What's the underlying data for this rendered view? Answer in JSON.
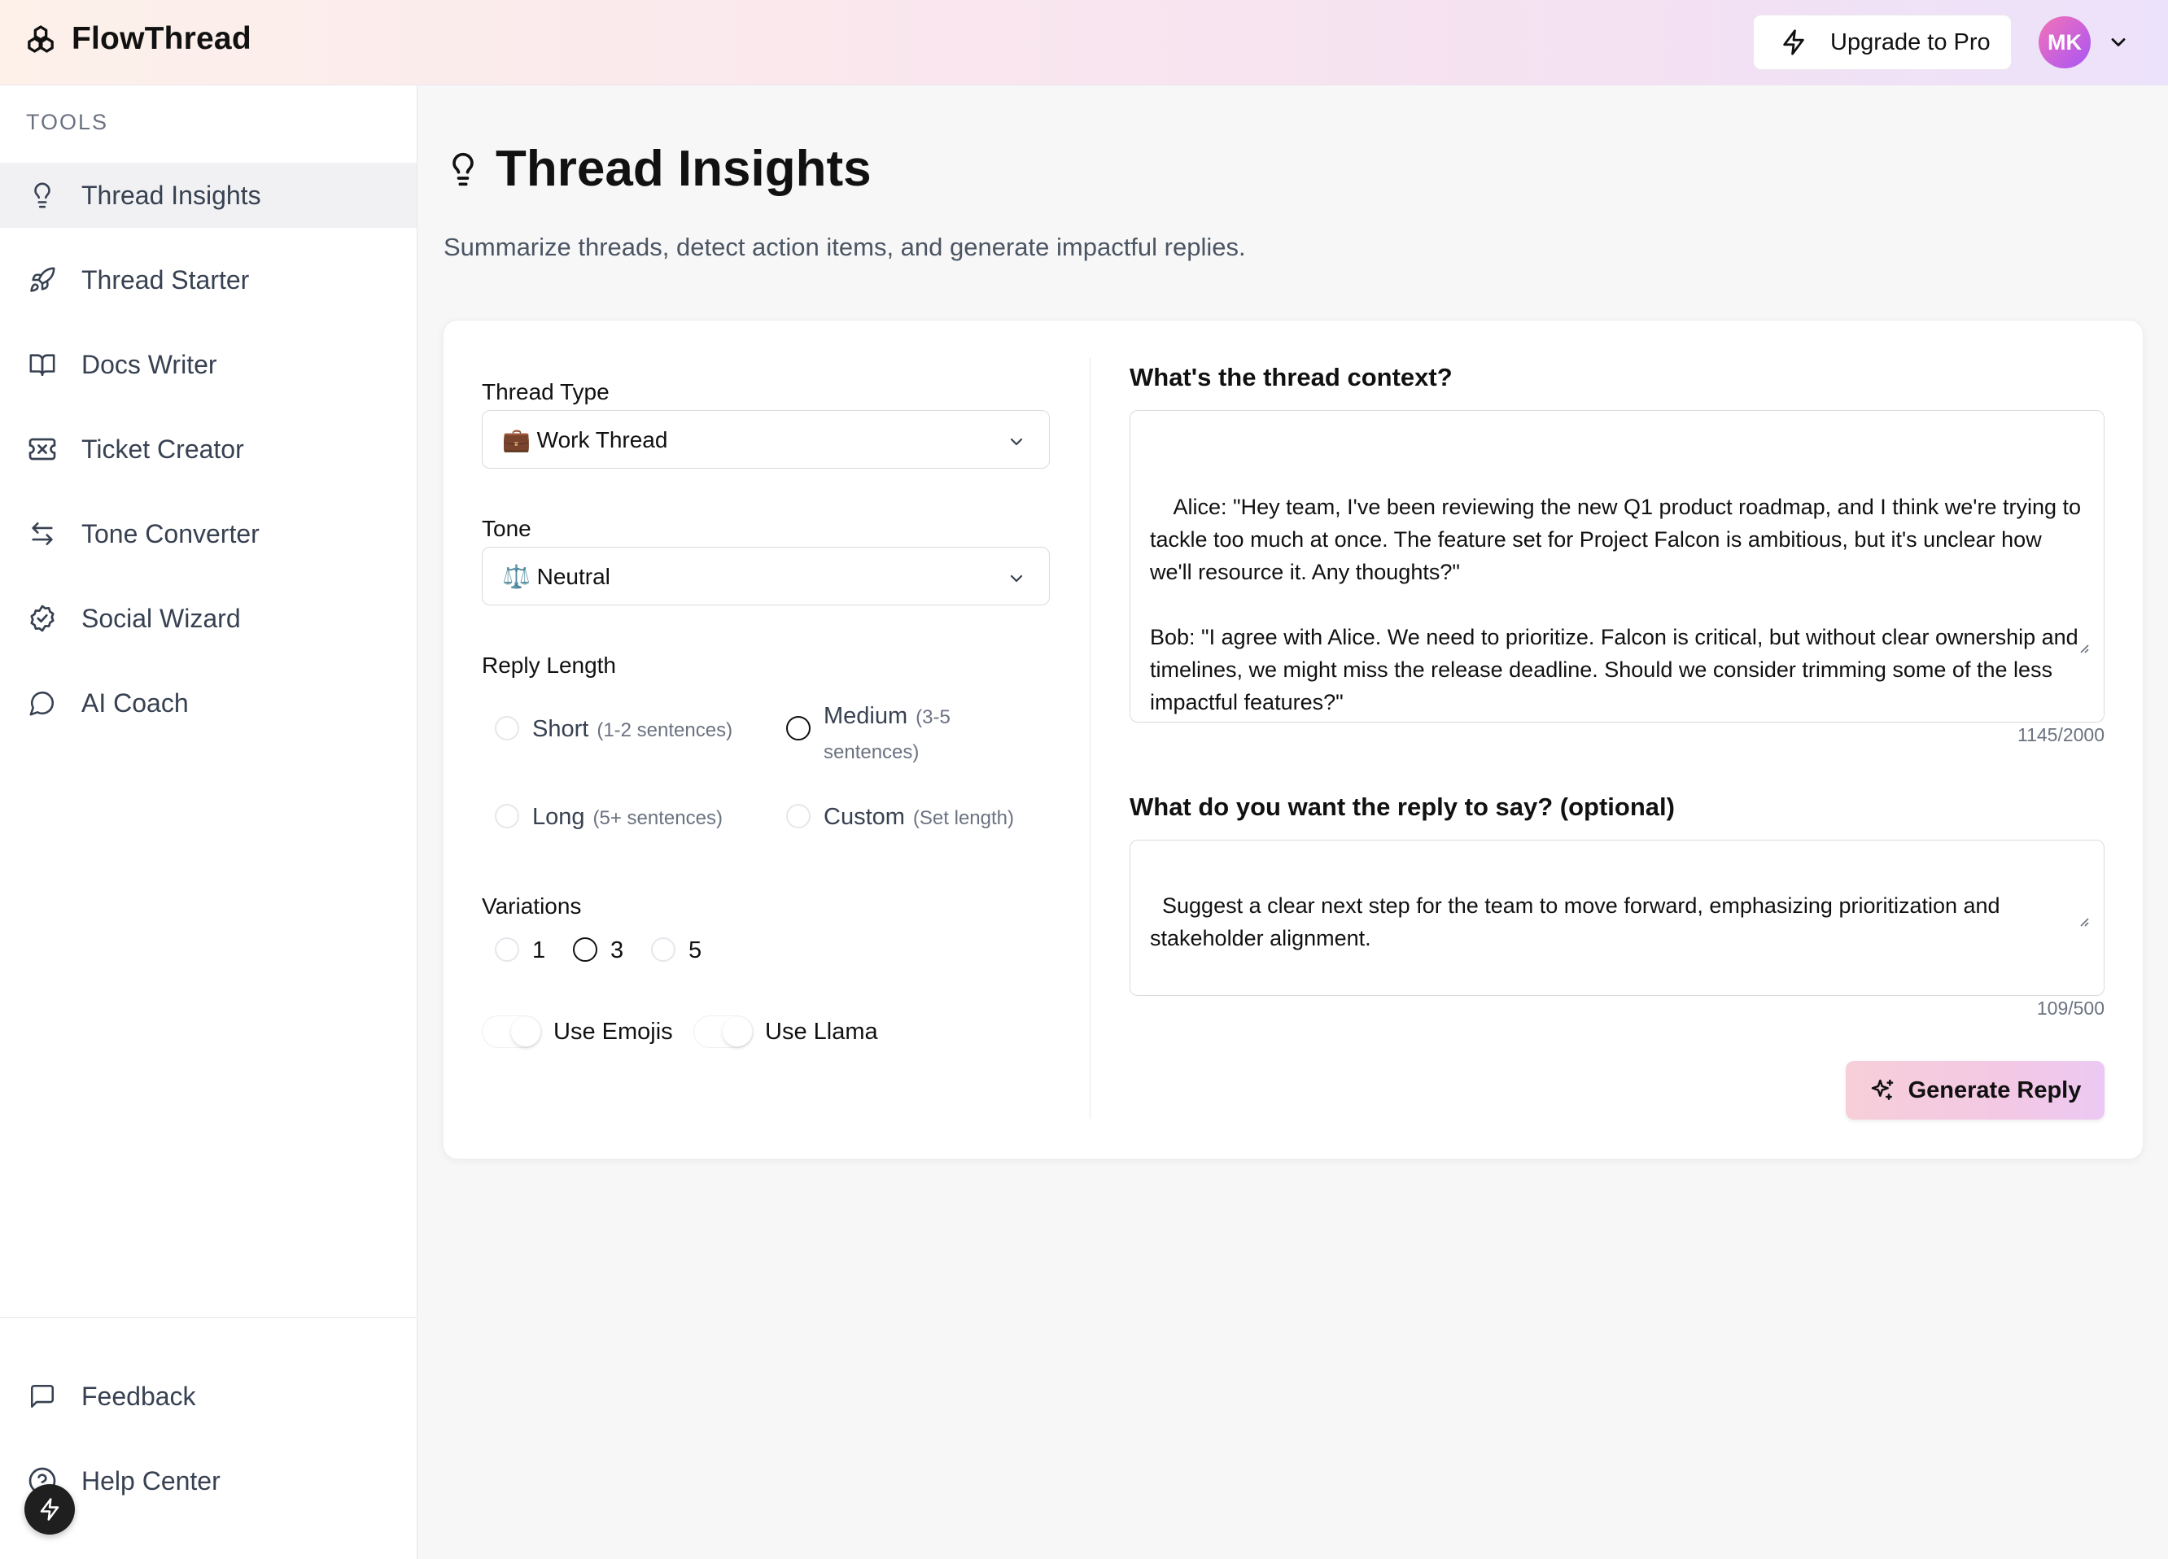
{
  "app": {
    "name": "FlowThread",
    "upgrade_label": "Upgrade to Pro",
    "user_initials": "MK"
  },
  "sidebar": {
    "section_label": "TOOLS",
    "items": [
      {
        "label": "Thread Insights",
        "icon": "lightbulb-icon",
        "active": true
      },
      {
        "label": "Thread Starter",
        "icon": "rocket-icon"
      },
      {
        "label": "Docs Writer",
        "icon": "book-open-icon"
      },
      {
        "label": "Ticket Creator",
        "icon": "ticket-icon"
      },
      {
        "label": "Tone Converter",
        "icon": "arrows-swap-icon"
      },
      {
        "label": "Social Wizard",
        "icon": "badge-check-icon"
      },
      {
        "label": "AI Coach",
        "icon": "message-circle-icon"
      }
    ],
    "footer_items": [
      {
        "label": "Feedback",
        "icon": "message-square-icon"
      },
      {
        "label": "Help Center",
        "icon": "help-circle-icon"
      }
    ]
  },
  "page": {
    "title": "Thread Insights",
    "subtitle": "Summarize threads, detect action items, and generate impactful replies."
  },
  "form": {
    "thread_type": {
      "label": "Thread Type",
      "value": "💼 Work Thread"
    },
    "tone": {
      "label": "Tone",
      "value": "⚖️ Neutral"
    },
    "reply_length": {
      "label": "Reply Length",
      "selected": "Medium",
      "options": [
        {
          "label": "Short",
          "hint": "(1-2 sentences)"
        },
        {
          "label": "Medium",
          "hint": "(3-5 sentences)"
        },
        {
          "label": "Long",
          "hint": "(5+ sentences)"
        },
        {
          "label": "Custom",
          "hint": "(Set length)"
        }
      ]
    },
    "variations": {
      "label": "Variations",
      "options": [
        "1",
        "3",
        "5"
      ],
      "selected": "3"
    },
    "toggles": {
      "emojis": "Use Emojis",
      "llama": "Use Llama"
    }
  },
  "context": {
    "heading": "What's the thread context?",
    "value": "  Alice: \"Hey team, I've been reviewing the new Q1 product roadmap, and I think we're trying to tackle too much at once. The feature set for Project Falcon is ambitious, but it's unclear how we'll resource it. Any thoughts?\"\n\nBob: \"I agree with Alice. We need to prioritize. Falcon is critical, but without clear ownership and timelines, we might miss the release deadline. Should we consider trimming some of the less impactful features?\"",
    "counter": "1145/2000"
  },
  "reply": {
    "heading": "What do you want the reply to say? (optional)",
    "value": "Suggest a clear next step for the team to move forward, emphasizing prioritization and stakeholder alignment.",
    "counter": "109/500"
  },
  "generate_label": "Generate Reply"
}
